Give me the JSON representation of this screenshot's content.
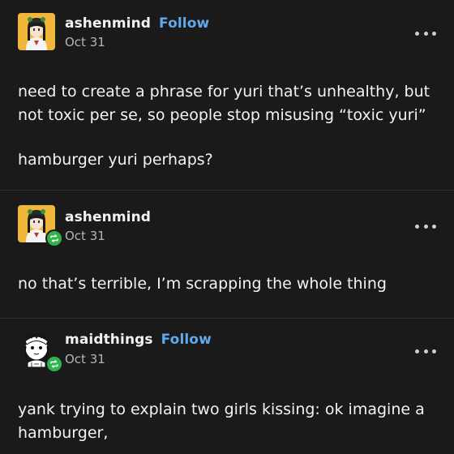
{
  "posts": [
    {
      "username": "ashenmind",
      "follow_label": "Follow",
      "date": "Oct 31",
      "avatar_icon": "anime-girl-avatar",
      "more_icon": "more-options-icon",
      "paragraphs": [
        "need to create a phrase for yuri that’s unhealthy, but not toxic per se, so people stop misusing “toxic yuri”",
        "hamburger yuri perhaps?"
      ]
    },
    {
      "username": "ashenmind",
      "date": "Oct 31",
      "avatar_icon": "anime-girl-avatar",
      "reblog_icon": "reblog-icon",
      "more_icon": "more-options-icon",
      "paragraphs": [
        "no that’s terrible, I’m scrapping the whole thing"
      ]
    },
    {
      "username": "maidthings",
      "follow_label": "Follow",
      "date": "Oct 31",
      "avatar_icon": "maid-sketch-avatar",
      "reblog_icon": "reblog-icon",
      "more_icon": "more-options-icon",
      "paragraphs": [
        "yank trying to explain two girls kissing: ok imagine a hamburger,"
      ]
    }
  ],
  "colors": {
    "background": "#1a1a1a",
    "text": "#f3f3f3",
    "date": "#b5b5b5",
    "follow": "#5fa9ec",
    "reblog_badge": "#2fb34a",
    "avatar_bg": "#f2b73a"
  }
}
